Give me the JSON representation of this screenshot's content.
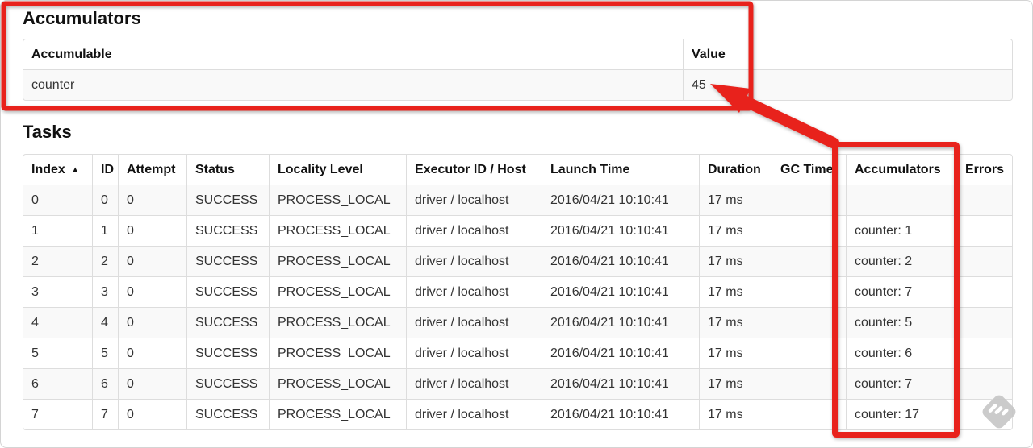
{
  "accumulators_section": {
    "title": "Accumulators",
    "headers": [
      "Accumulable",
      "Value"
    ],
    "row": {
      "name": "counter",
      "value": "45"
    }
  },
  "tasks_section": {
    "title": "Tasks",
    "sort_indicator": "▲",
    "headers": [
      "Index",
      "ID",
      "Attempt",
      "Status",
      "Locality Level",
      "Executor ID / Host",
      "Launch Time",
      "Duration",
      "GC Time",
      "Accumulators",
      "Errors"
    ],
    "rows": [
      [
        "0",
        "0",
        "0",
        "SUCCESS",
        "PROCESS_LOCAL",
        "driver / localhost",
        "2016/04/21 10:10:41",
        "17 ms",
        "",
        "",
        ""
      ],
      [
        "1",
        "1",
        "0",
        "SUCCESS",
        "PROCESS_LOCAL",
        "driver / localhost",
        "2016/04/21 10:10:41",
        "17 ms",
        "",
        "counter: 1",
        ""
      ],
      [
        "2",
        "2",
        "0",
        "SUCCESS",
        "PROCESS_LOCAL",
        "driver / localhost",
        "2016/04/21 10:10:41",
        "17 ms",
        "",
        "counter: 2",
        ""
      ],
      [
        "3",
        "3",
        "0",
        "SUCCESS",
        "PROCESS_LOCAL",
        "driver / localhost",
        "2016/04/21 10:10:41",
        "17 ms",
        "",
        "counter: 7",
        ""
      ],
      [
        "4",
        "4",
        "0",
        "SUCCESS",
        "PROCESS_LOCAL",
        "driver / localhost",
        "2016/04/21 10:10:41",
        "17 ms",
        "",
        "counter: 5",
        ""
      ],
      [
        "5",
        "5",
        "0",
        "SUCCESS",
        "PROCESS_LOCAL",
        "driver / localhost",
        "2016/04/21 10:10:41",
        "17 ms",
        "",
        "counter: 6",
        ""
      ],
      [
        "6",
        "6",
        "0",
        "SUCCESS",
        "PROCESS_LOCAL",
        "driver / localhost",
        "2016/04/21 10:10:41",
        "17 ms",
        "",
        "counter: 7",
        ""
      ],
      [
        "7",
        "7",
        "0",
        "SUCCESS",
        "PROCESS_LOCAL",
        "driver / localhost",
        "2016/04/21 10:10:41",
        "17 ms",
        "",
        "counter: 17",
        ""
      ]
    ]
  },
  "colors": {
    "annotation_red": "#e8231d",
    "stripe_bg": "#f9f9f9",
    "table_border": "#dddddd",
    "watermark_gray": "#c6c6c6"
  }
}
